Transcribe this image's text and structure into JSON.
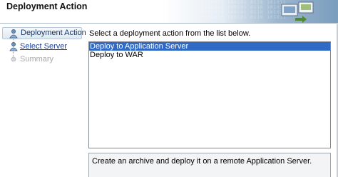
{
  "header": {
    "title": "Deployment Action",
    "pattern_text": "0101010 100101 0110 1010110 010 0101 1101001 01010110 1001 0110101 0101101"
  },
  "nav": {
    "items": [
      {
        "label": "Deployment Action",
        "state": "active",
        "icon": "step-person-icon"
      },
      {
        "label": "Select Server",
        "state": "link",
        "icon": "step-person-icon"
      },
      {
        "label": "Summary",
        "state": "disabled",
        "icon": "step-dot-icon"
      }
    ]
  },
  "main": {
    "instruction": "Select a deployment action from the list below.",
    "actions": [
      {
        "label": "Deploy to Application Server",
        "selected": true
      },
      {
        "label": "Deploy to WAR",
        "selected": false
      }
    ],
    "description": "Create an archive and deploy it on a remote Application Server."
  },
  "colors": {
    "selection": "#3169c6",
    "link": "#1a3f9a",
    "disabled": "#a8a8a8",
    "header_gradient_end": "#7a9dbd"
  }
}
